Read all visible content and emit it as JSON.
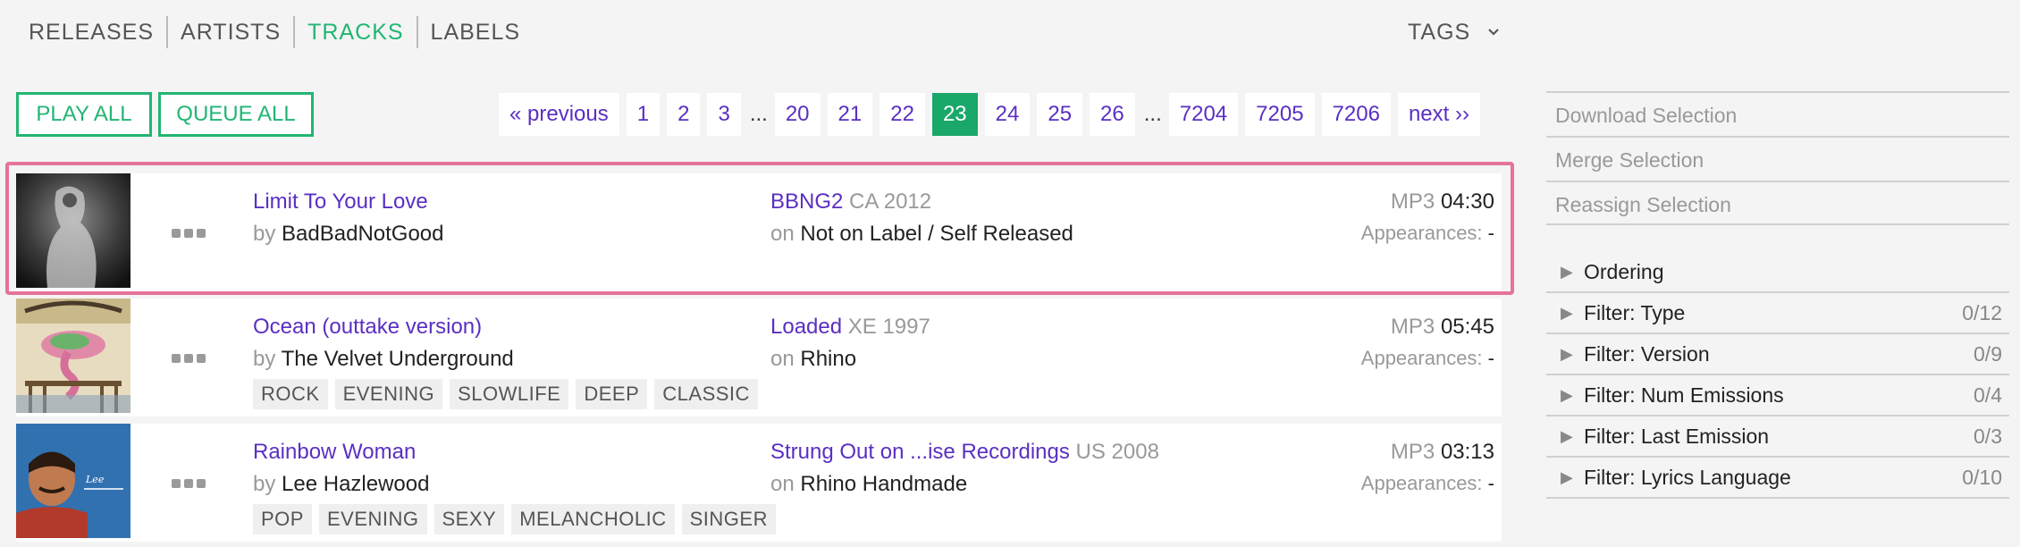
{
  "nav": {
    "items": [
      "RELEASES",
      "ARTISTS",
      "TRACKS",
      "LABELS"
    ],
    "active_index": 2,
    "tags_label": "TAGS"
  },
  "actions": {
    "play_all": "PLAY ALL",
    "queue_all": "QUEUE ALL"
  },
  "pagination": {
    "previous": "« previous",
    "next": "next ››",
    "ellipsis": "...",
    "pages_left": [
      "1",
      "2",
      "3"
    ],
    "pages_mid": [
      "20",
      "21",
      "22",
      "23",
      "24",
      "25",
      "26"
    ],
    "pages_right": [
      "7204",
      "7205",
      "7206"
    ],
    "current": "23"
  },
  "tracks": [
    {
      "title": "Limit To Your Love",
      "by_prefix": "by",
      "artist": "BadBadNotGood",
      "release": "BBNG2",
      "release_meta": "CA 2012",
      "on_prefix": "on",
      "label": "Not on Label / Self Released",
      "format": "MP3",
      "duration": "04:30",
      "appearances_label": "Appearances:",
      "appearances": "-",
      "tags": []
    },
    {
      "title": "Ocean (outtake version)",
      "by_prefix": "by",
      "artist": "The Velvet Underground",
      "release": "Loaded",
      "release_meta": "XE 1997",
      "on_prefix": "on",
      "label": "Rhino",
      "format": "MP3",
      "duration": "05:45",
      "appearances_label": "Appearances:",
      "appearances": "-",
      "tags": [
        "ROCK",
        "EVENING",
        "SLOWLIFE",
        "DEEP",
        "CLASSIC"
      ]
    },
    {
      "title": "Rainbow Woman",
      "by_prefix": "by",
      "artist": "Lee Hazlewood",
      "release": "Strung Out on ...ise Recordings",
      "release_meta": "US 2008",
      "on_prefix": "on",
      "label": "Rhino Handmade",
      "format": "MP3",
      "duration": "03:13",
      "appearances_label": "Appearances:",
      "appearances": "-",
      "tags": [
        "POP",
        "EVENING",
        "SEXY",
        "MELANCHOLIC",
        "SINGER"
      ]
    }
  ],
  "sidebar": {
    "actions": [
      "Download Selection",
      "Merge Selection",
      "Reassign Selection"
    ],
    "filters": [
      {
        "label": "Ordering",
        "count": ""
      },
      {
        "label": "Filter: Type",
        "count": "0/12"
      },
      {
        "label": "Filter: Version",
        "count": "0/9"
      },
      {
        "label": "Filter: Num Emissions",
        "count": "0/4"
      },
      {
        "label": "Filter: Last Emission",
        "count": "0/3"
      },
      {
        "label": "Filter: Lyrics Language",
        "count": "0/10"
      }
    ]
  },
  "colors": {
    "accent": "#22b573",
    "link": "#5a2fc2",
    "selection": "#e5739a"
  }
}
